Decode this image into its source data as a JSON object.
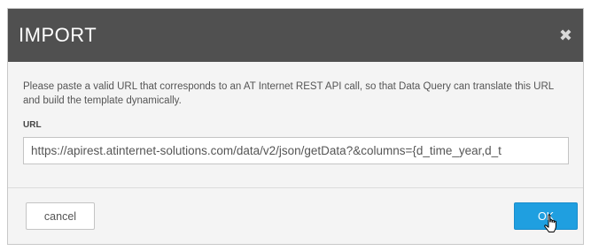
{
  "dialog": {
    "title": "IMPORT",
    "close_icon": "close-icon",
    "description": "Please paste a valid URL that corresponds to an AT Internet REST API call, so that Data Query can translate this URL and build the template dynamically.",
    "url_label": "URL",
    "url_value": "https://apirest.atinternet-solutions.com/data/v2/json/getData?&columns={d_time_year,d_t",
    "cancel_label": "cancel",
    "ok_label": "OK"
  },
  "colors": {
    "header_bg": "#505050",
    "ok_button": "#1f9fe0"
  }
}
